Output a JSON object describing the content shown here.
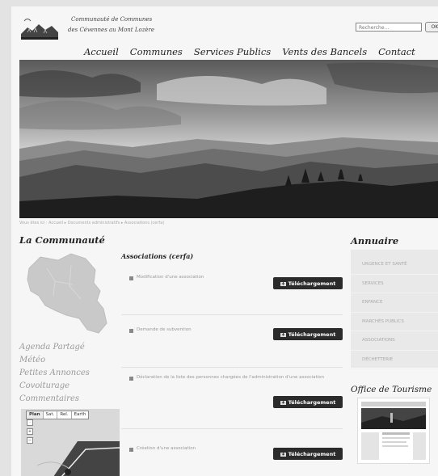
{
  "header": {
    "org_line1": "Communauté de Communes",
    "org_line2": "des Cévennes au Mont Lozère"
  },
  "search": {
    "placeholder": "Recherche...",
    "button_label": "OK"
  },
  "nav": {
    "items": [
      "Accueil",
      "Communes",
      "Services Publics",
      "Vents des Bancels",
      "Contact"
    ]
  },
  "breadcrumb": "Vous êtes ici : Accueil ▸ Documents administratifs ▸ Associations (cerfa)",
  "left": {
    "title": "La Communauté",
    "links": [
      "Agenda Partagé",
      "Météo",
      "Petites Annonces",
      "Covoiturage",
      "Commentaires"
    ],
    "map_tabs": [
      "Plan",
      "Sat.",
      "Rel.",
      "Earth"
    ]
  },
  "main": {
    "title": "Associations (cerfa)",
    "download_label": "Téléchargement",
    "documents": [
      "Modification d'une association",
      "Demande de subvention",
      "Déclaration de la liste des personnes chargées de l'administration d'une association",
      "Création d'une association"
    ]
  },
  "right": {
    "annuaire_title": "Annuaire",
    "annuaire_items": [
      "URGENCE ET SANTÉ",
      "SERVICES",
      "ENFANCE",
      "MARCHÉS PUBLICS",
      "ASSOCIATIONS",
      "DÉCHETTERIE"
    ],
    "tourisme_title": "Office de Tourisme"
  },
  "colors": {
    "background": "#e3e3e3",
    "page": "#f6f6f6",
    "button": "#2b2b2b",
    "annuaire_box": "#e9e9e9"
  }
}
